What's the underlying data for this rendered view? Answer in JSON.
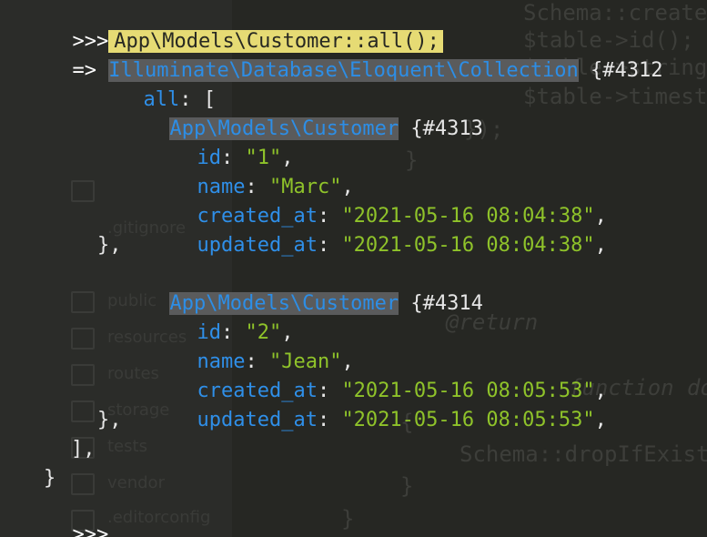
{
  "background": {
    "code_lines": [
      "Schema::create(",
      "$table->id();",
      "$table->string",
      "$table->timestamps",
      "});",
      "}",
      "@return",
      "function down",
      "{",
      "Schema::dropIfExists",
      "}",
      "}"
    ],
    "tree_items": [
      ".gitignore",
      "public",
      "resources",
      "routes",
      "storage",
      "tests",
      "vendor",
      ".editorconfig"
    ]
  },
  "terminal": {
    "prompt": ">>>",
    "result_arrow": "=>",
    "command": "App\\Models\\Customer::all();",
    "collection_class": "Illuminate\\Database\\Eloquent\\Collection",
    "collection_ref": "{#4312",
    "all_key": "all",
    "records": [
      {
        "class": "App\\Models\\Customer",
        "ref": "{#4313",
        "fields": [
          {
            "key": "id",
            "value": "\"1\""
          },
          {
            "key": "name",
            "value": "\"Marc\""
          },
          {
            "key": "created_at",
            "value": "\"2021-05-16 08:04:38\""
          },
          {
            "key": "updated_at",
            "value": "\"2021-05-16 08:04:38\""
          }
        ]
      },
      {
        "class": "App\\Models\\Customer",
        "ref": "{#4314",
        "fields": [
          {
            "key": "id",
            "value": "\"2\""
          },
          {
            "key": "name",
            "value": "\"Jean\""
          },
          {
            "key": "created_at",
            "value": "\"2021-05-16 08:05:53\""
          },
          {
            "key": "updated_at",
            "value": "\"2021-05-16 08:05:53\""
          }
        ]
      }
    ],
    "final_prompt": ">>>"
  },
  "colors": {
    "background": "#272825",
    "command_highlight": "#e6db74",
    "class_highlight": "#5a5b5c",
    "key": "#2f8fe8",
    "string": "#8fc32a"
  }
}
